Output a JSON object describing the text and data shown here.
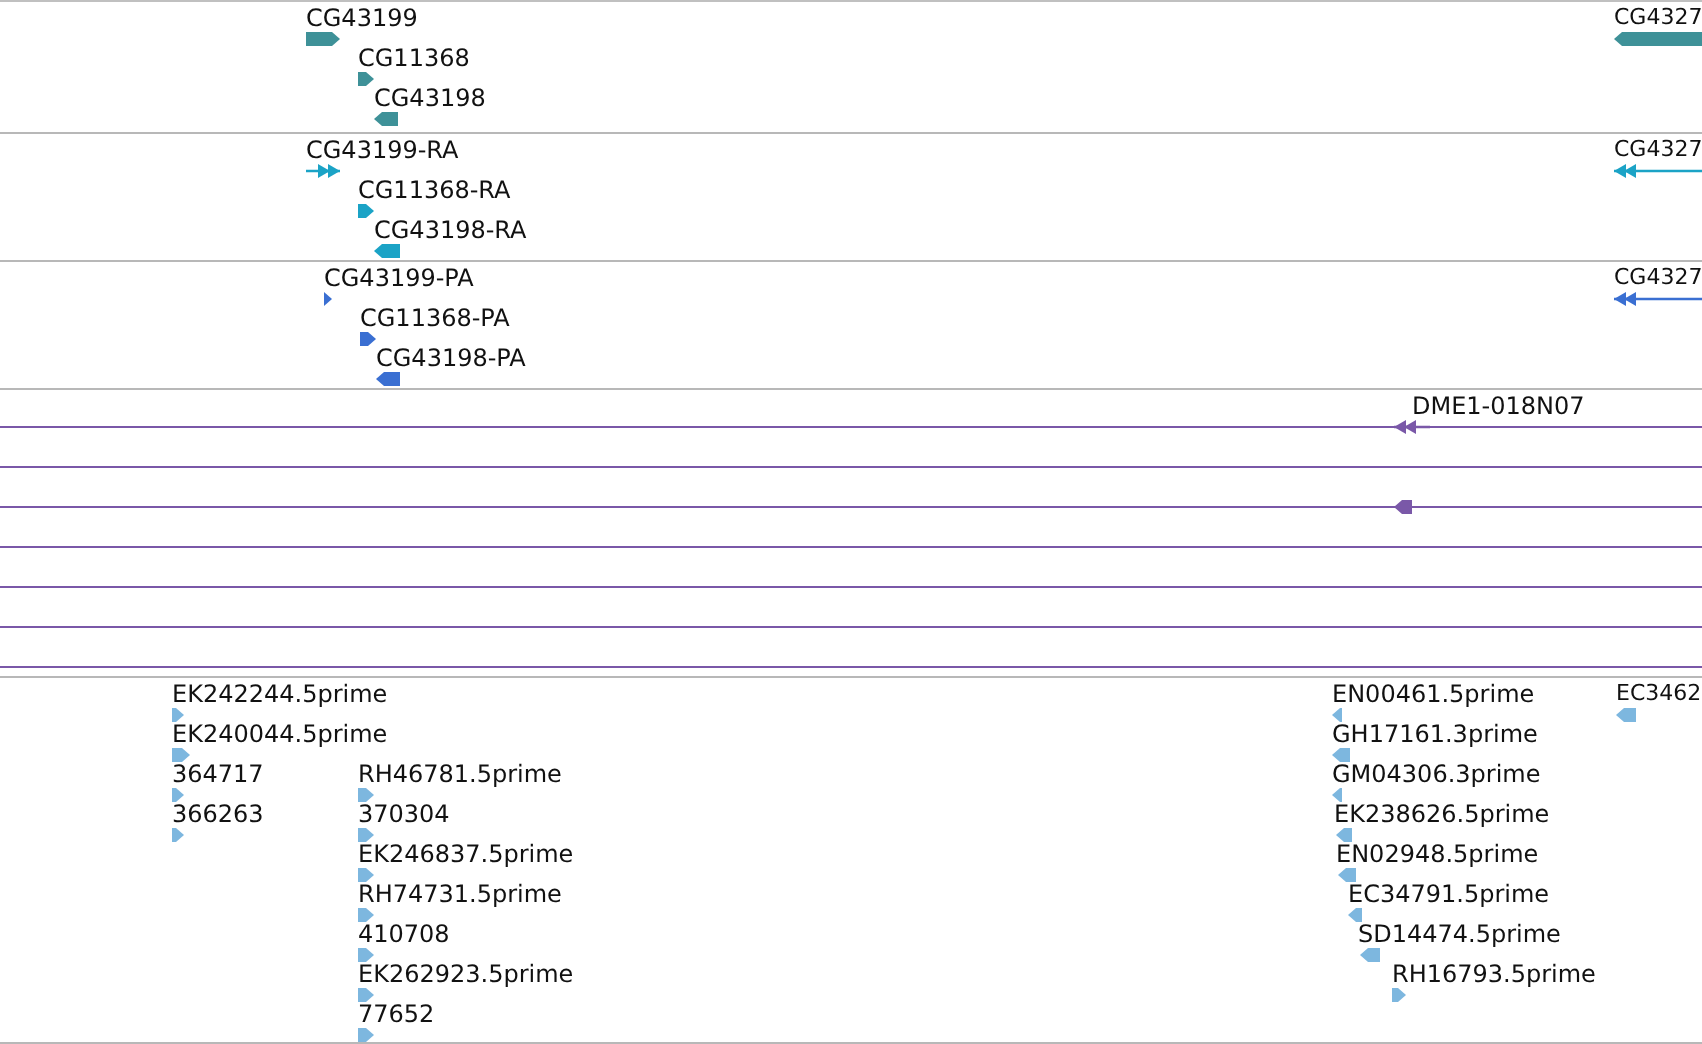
{
  "tracks": [
    {
      "kind": "gene",
      "color": "#3e9198",
      "features": [
        {
          "label": "CG43199",
          "reverse": false
        },
        {
          "label": "CG11368",
          "reverse": false
        },
        {
          "label": "CG43198",
          "reverse": true
        },
        {
          "label": "CG4327",
          "reverse": true
        }
      ]
    },
    {
      "kind": "transcript",
      "color": "#1ba3c6",
      "features": [
        {
          "label": "CG43199-RA",
          "reverse": false
        },
        {
          "label": "CG11368-RA",
          "reverse": false
        },
        {
          "label": "CG43198-RA",
          "reverse": true
        },
        {
          "label": "CG4327",
          "reverse": true
        }
      ]
    },
    {
      "kind": "transcript",
      "color": "#3a6fd2",
      "features": [
        {
          "label": "CG43199-PA",
          "reverse": false
        },
        {
          "label": "CG11368-PA",
          "reverse": false
        },
        {
          "label": "CG43198-PA",
          "reverse": true
        },
        {
          "label": "CG4327",
          "reverse": true
        }
      ]
    },
    {
      "kind": "alignment",
      "color": "#7a58a8",
      "features": [
        {
          "label": "DME1-018N07",
          "reverse": true
        }
      ]
    },
    {
      "kind": "est",
      "color": "#7db7df",
      "features": [
        {
          "label": "EK242244.5prime",
          "reverse": false
        },
        {
          "label": "EK240044.5prime",
          "reverse": false
        },
        {
          "label": "364717",
          "reverse": false
        },
        {
          "label": "366263",
          "reverse": false
        },
        {
          "label": "RH46781.5prime",
          "reverse": false
        },
        {
          "label": "370304",
          "reverse": false
        },
        {
          "label": "EK246837.5prime",
          "reverse": false
        },
        {
          "label": "RH74731.5prime",
          "reverse": false
        },
        {
          "label": "410708",
          "reverse": false
        },
        {
          "label": "EK262923.5prime",
          "reverse": false
        },
        {
          "label": "77652",
          "reverse": false
        },
        {
          "label": "EN00461.5prime",
          "reverse": true
        },
        {
          "label": "GH17161.3prime",
          "reverse": true
        },
        {
          "label": "GM04306.3prime",
          "reverse": true
        },
        {
          "label": "EK238626.5prime",
          "reverse": true
        },
        {
          "label": "EN02948.5prime",
          "reverse": true
        },
        {
          "label": "EC34791.5prime",
          "reverse": true
        },
        {
          "label": "SD14474.5prime",
          "reverse": true
        },
        {
          "label": "RH16793.5prime",
          "reverse": false
        },
        {
          "label": "EC3462",
          "reverse": true
        }
      ]
    }
  ]
}
